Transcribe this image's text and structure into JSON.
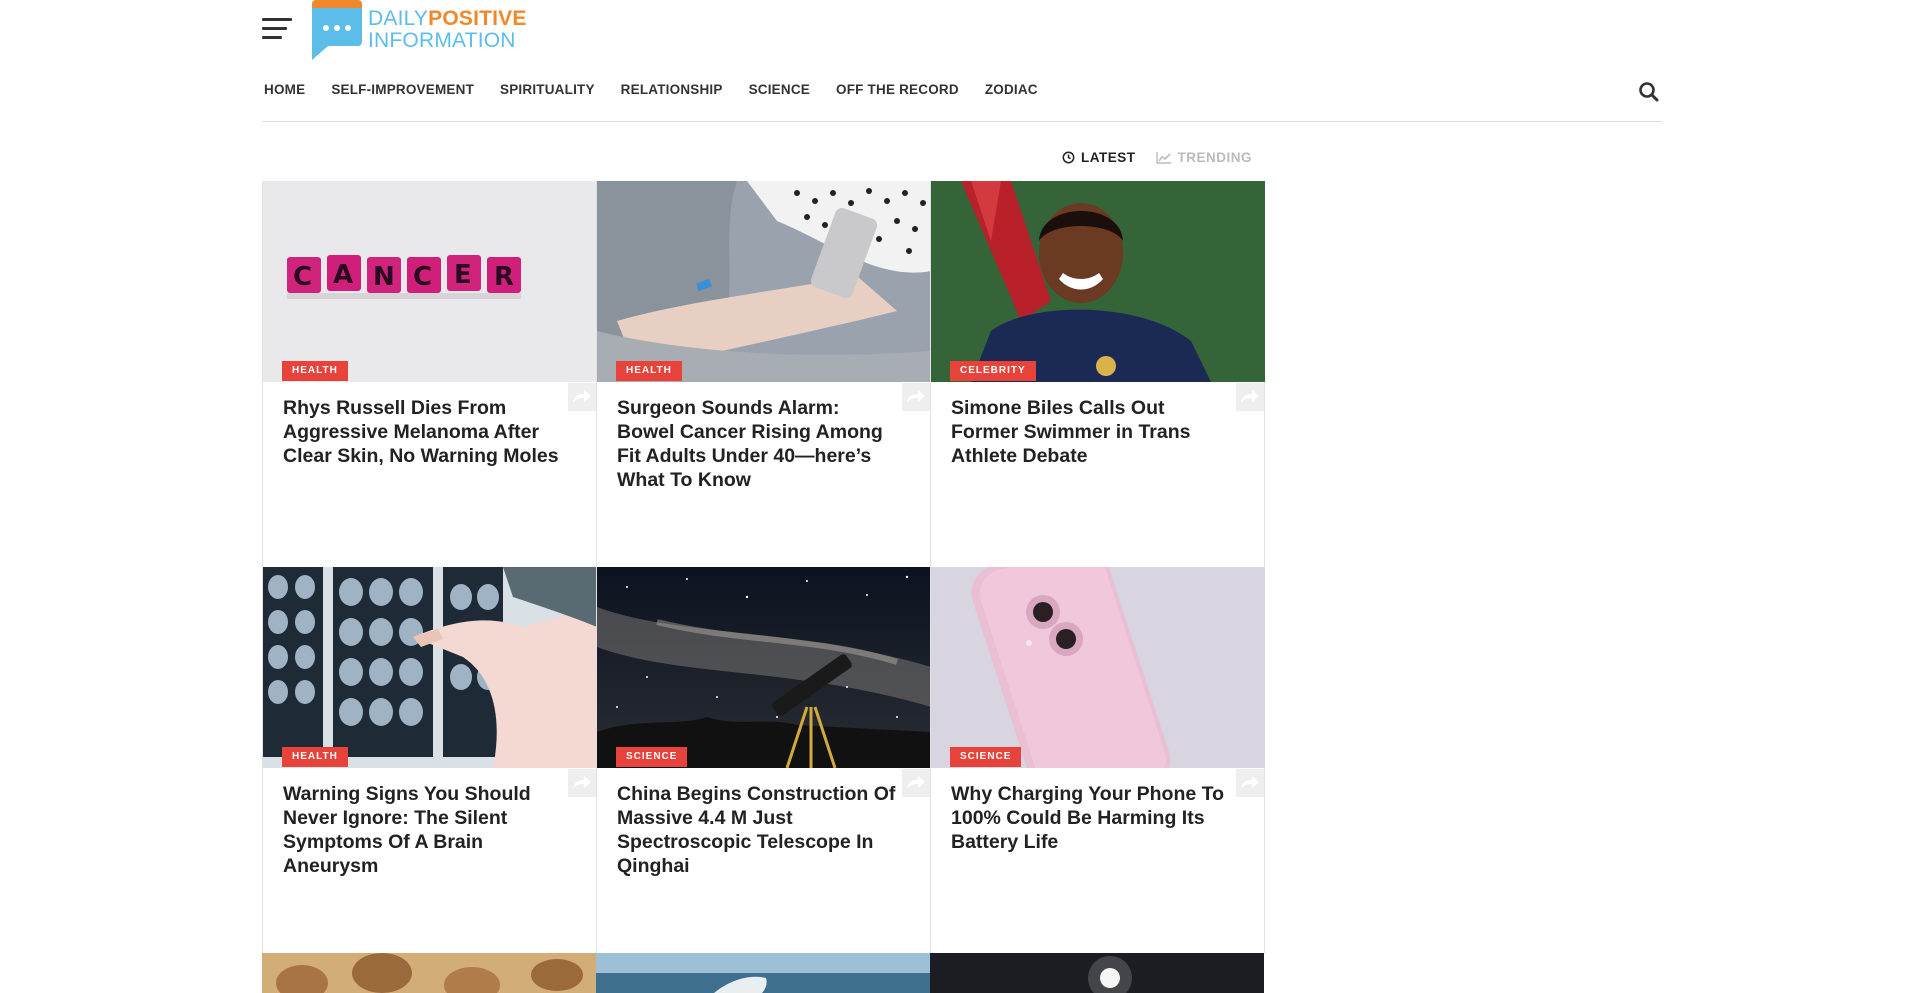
{
  "site": {
    "logo_daily": "DAILY",
    "logo_positive": "POSITIVE",
    "logo_information": "INFORMATION"
  },
  "nav": {
    "items": [
      "HOME",
      "SELF-IMPROVEMENT",
      "SPIRITUALITY",
      "RELATIONSHIP",
      "SCIENCE",
      "OFF THE RECORD",
      "ZODIAC"
    ]
  },
  "tabs": {
    "latest": "LATEST",
    "trending": "TRENDING"
  },
  "articles": [
    {
      "category": "HEALTH",
      "title": "Rhys Russell Dies From Aggressive Melanoma After Clear Skin, No Warning Moles",
      "image": "cancer-tiles"
    },
    {
      "category": "HEALTH",
      "title": "Surgeon Sounds Alarm: Bowel Cancer Rising Among Fit Adults Under 40—here’s What To Know",
      "image": "hospital-phone"
    },
    {
      "category": "CELEBRITY",
      "title": "Simone Biles Calls Out Former Swimmer in Trans Athlete Debate",
      "image": "athlete-smiling"
    },
    {
      "category": "HEALTH",
      "title": "Warning Signs You Should Never Ignore: The Silent Symptoms Of A Brain Aneurysm",
      "image": "brain-scans"
    },
    {
      "category": "SCIENCE",
      "title": "China Begins Construction Of Massive 4.4 M Just Spectroscopic Telescope In Qinghai",
      "image": "telescope-night"
    },
    {
      "category": "SCIENCE",
      "title": "Why Charging Your Phone To 100% Could Be Harming Its Battery Life",
      "image": "pink-phone"
    }
  ],
  "colors": {
    "accent": "#e8433a",
    "logo_blue": "#5bbde8",
    "logo_orange": "#f0892c"
  }
}
